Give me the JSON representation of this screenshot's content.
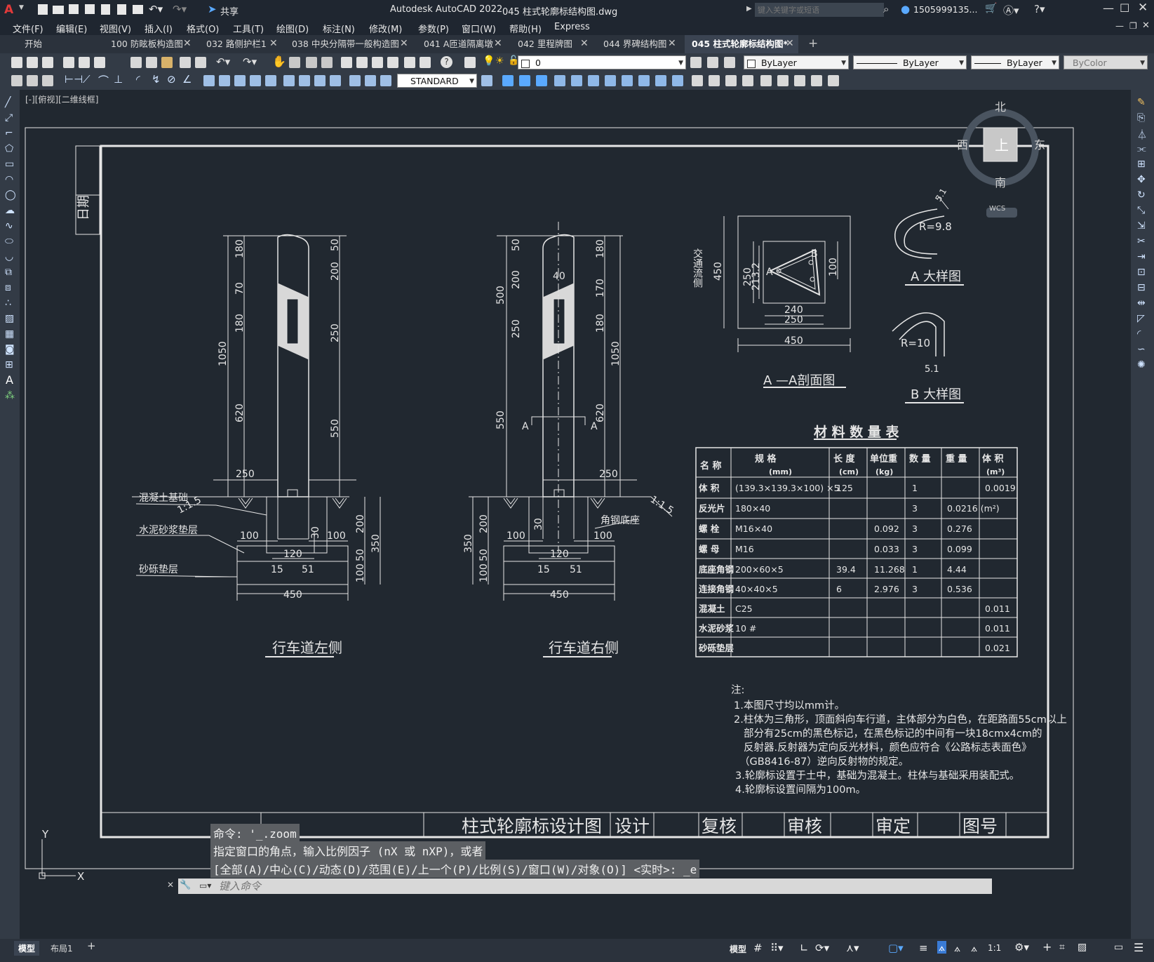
{
  "titlebar": {
    "app_title": "Autodesk AutoCAD 2022",
    "doc_title": "045 柱式轮廓标结构图.dwg",
    "share_label": "共享",
    "search_placeholder": "键入关键字或短语",
    "user": "1505999135...",
    "colors": {
      "bg": "#1f2630",
      "logo": "#e23a3a"
    }
  },
  "menubar": {
    "items": [
      "文件(F)",
      "编辑(E)",
      "视图(V)",
      "插入(I)",
      "格式(O)",
      "工具(T)",
      "绘图(D)",
      "标注(N)",
      "修改(M)",
      "参数(P)",
      "窗口(W)",
      "帮助(H)",
      "Express"
    ]
  },
  "tabs": [
    {
      "label": "开始"
    },
    {
      "label": "100 防眩板构造图"
    },
    {
      "label": "032 路侧护栏1"
    },
    {
      "label": "038 中央分隔带一般构造图"
    },
    {
      "label": "041 A匝道隔离墩"
    },
    {
      "label": "042 里程牌图"
    },
    {
      "label": "044 界碑结构图"
    },
    {
      "label": "045 柱式轮廓标结构图*"
    }
  ],
  "toolbar": {
    "layer_value": "0",
    "color_value": "ByLayer",
    "linetype_value": "ByLayer",
    "lineweight_value": "ByLayer",
    "plotstyle_value": "ByColor",
    "textstyle_value": "STANDARD"
  },
  "viewport": {
    "label": "[-][俯视][二维线框]",
    "viewcube": {
      "top": "上",
      "north": "北",
      "south": "南",
      "east": "东",
      "west": "西",
      "wcs": "WCS"
    }
  },
  "drawing": {
    "date_label": "日期",
    "left_view_title": "行车道左侧",
    "right_view_title": "行车道右侧",
    "left_labels": {
      "foundation": "混凝土基础",
      "mortar": "水泥砂浆垫层",
      "gravel": "砂砾垫层",
      "slope": "1:1.5"
    },
    "right_labels": {
      "angle_base": "角钢底座",
      "slope": "1:1.5",
      "section_a": "A"
    },
    "left_dims": [
      "180",
      "70",
      "180",
      "1050",
      "620",
      "50",
      "200",
      "250",
      "550",
      "250",
      "100",
      "30",
      "100",
      "120",
      "15",
      "51",
      "450",
      "200",
      "350",
      "50",
      "100"
    ],
    "right_dims": [
      "50",
      "200",
      "500",
      "250",
      "40",
      "550",
      "180",
      "170",
      "180",
      "1050",
      "620",
      "250",
      "200",
      "350",
      "30",
      "100",
      "100",
      "120",
      "15",
      "51",
      "450",
      "50",
      "100"
    ],
    "section_aa": {
      "title": "A —A剖面图",
      "side_label": "交通流侧",
      "dims": [
        "450",
        "250",
        "213.2",
        "100",
        "240",
        "250",
        "450"
      ],
      "points": [
        "A",
        "B"
      ]
    },
    "detail_a": {
      "title": "A 大样图",
      "radius": "R=9.8",
      "dim": "5.1"
    },
    "detail_b": {
      "title": "B 大样图",
      "radius": "R=10",
      "dim": "5.1"
    }
  },
  "material_table": {
    "title": "材 料 数 量 表",
    "headers": [
      "名 称",
      "规 格",
      "长 度",
      "单位重",
      "数 量",
      "重 量",
      "体 积"
    ],
    "header_units": [
      "",
      "(mm)",
      "(cm)",
      "(kg)",
      "",
      "",
      "(m³)"
    ],
    "rows": [
      [
        "体 积",
        "(139.3×139.3×100) ×5",
        "125",
        "",
        "1",
        "",
        "0.0019"
      ],
      [
        "反光片",
        "180×40",
        "",
        "",
        "3",
        "0.0216 (m²)",
        ""
      ],
      [
        "螺 栓",
        "M16×40",
        "",
        "0.092",
        "3",
        "0.276",
        ""
      ],
      [
        "螺 母",
        "M16",
        "",
        "0.033",
        "3",
        "0.099",
        ""
      ],
      [
        "底座角钢",
        "200×60×5",
        "39.4",
        "11.268",
        "1",
        "4.44",
        ""
      ],
      [
        "连接角钢",
        "40×40×5",
        "6",
        "2.976",
        "3",
        "0.536",
        ""
      ],
      [
        "混凝土",
        "C25",
        "",
        "",
        "",
        "",
        "0.011"
      ],
      [
        "水泥砂浆",
        "10 #",
        "",
        "",
        "",
        "",
        "0.011"
      ],
      [
        "砂砾垫层",
        "",
        "",
        "",
        "",
        "",
        "0.021"
      ]
    ]
  },
  "notes": {
    "heading": "注:",
    "lines": [
      "1.本图尺寸均以mm计。",
      "2.柱体为三角形，顶面斜向车行道，主体部分为白色，在距路面55cm以上",
      "部分有25cm的黑色标记，在黑色标记的中间有一块18cmx4cm的",
      "反射器.反射器为定向反光材料，颜色应符合《公路标志表面色》",
      "（GB8416-87）逆向反射物的规定。",
      "3.轮廓标设置于土中，基础为混凝土。柱体与基础采用装配式。",
      "4.轮廓标设置间隔为100m。"
    ]
  },
  "title_block": {
    "drawing_name": "柱式轮廓标设计图",
    "cells": [
      "设计",
      "复核",
      "审核",
      "审定",
      "图号"
    ]
  },
  "command": {
    "history": [
      "命令: '_.zoom",
      "指定窗口的角点，输入比例因子 (nX 或 nXP)，或者",
      "[全部(A)/中心(C)/动态(D)/范围(E)/上一个(P)/比例(S)/窗口(W)/对象(O)] <实时>: _e"
    ],
    "placeholder": "键入命令"
  },
  "statusbar": {
    "layout_tabs": [
      "模型",
      "布局1"
    ],
    "model_label": "模型",
    "scale": "1:1"
  },
  "ucs": {
    "x_label": "X",
    "y_label": "Y"
  }
}
